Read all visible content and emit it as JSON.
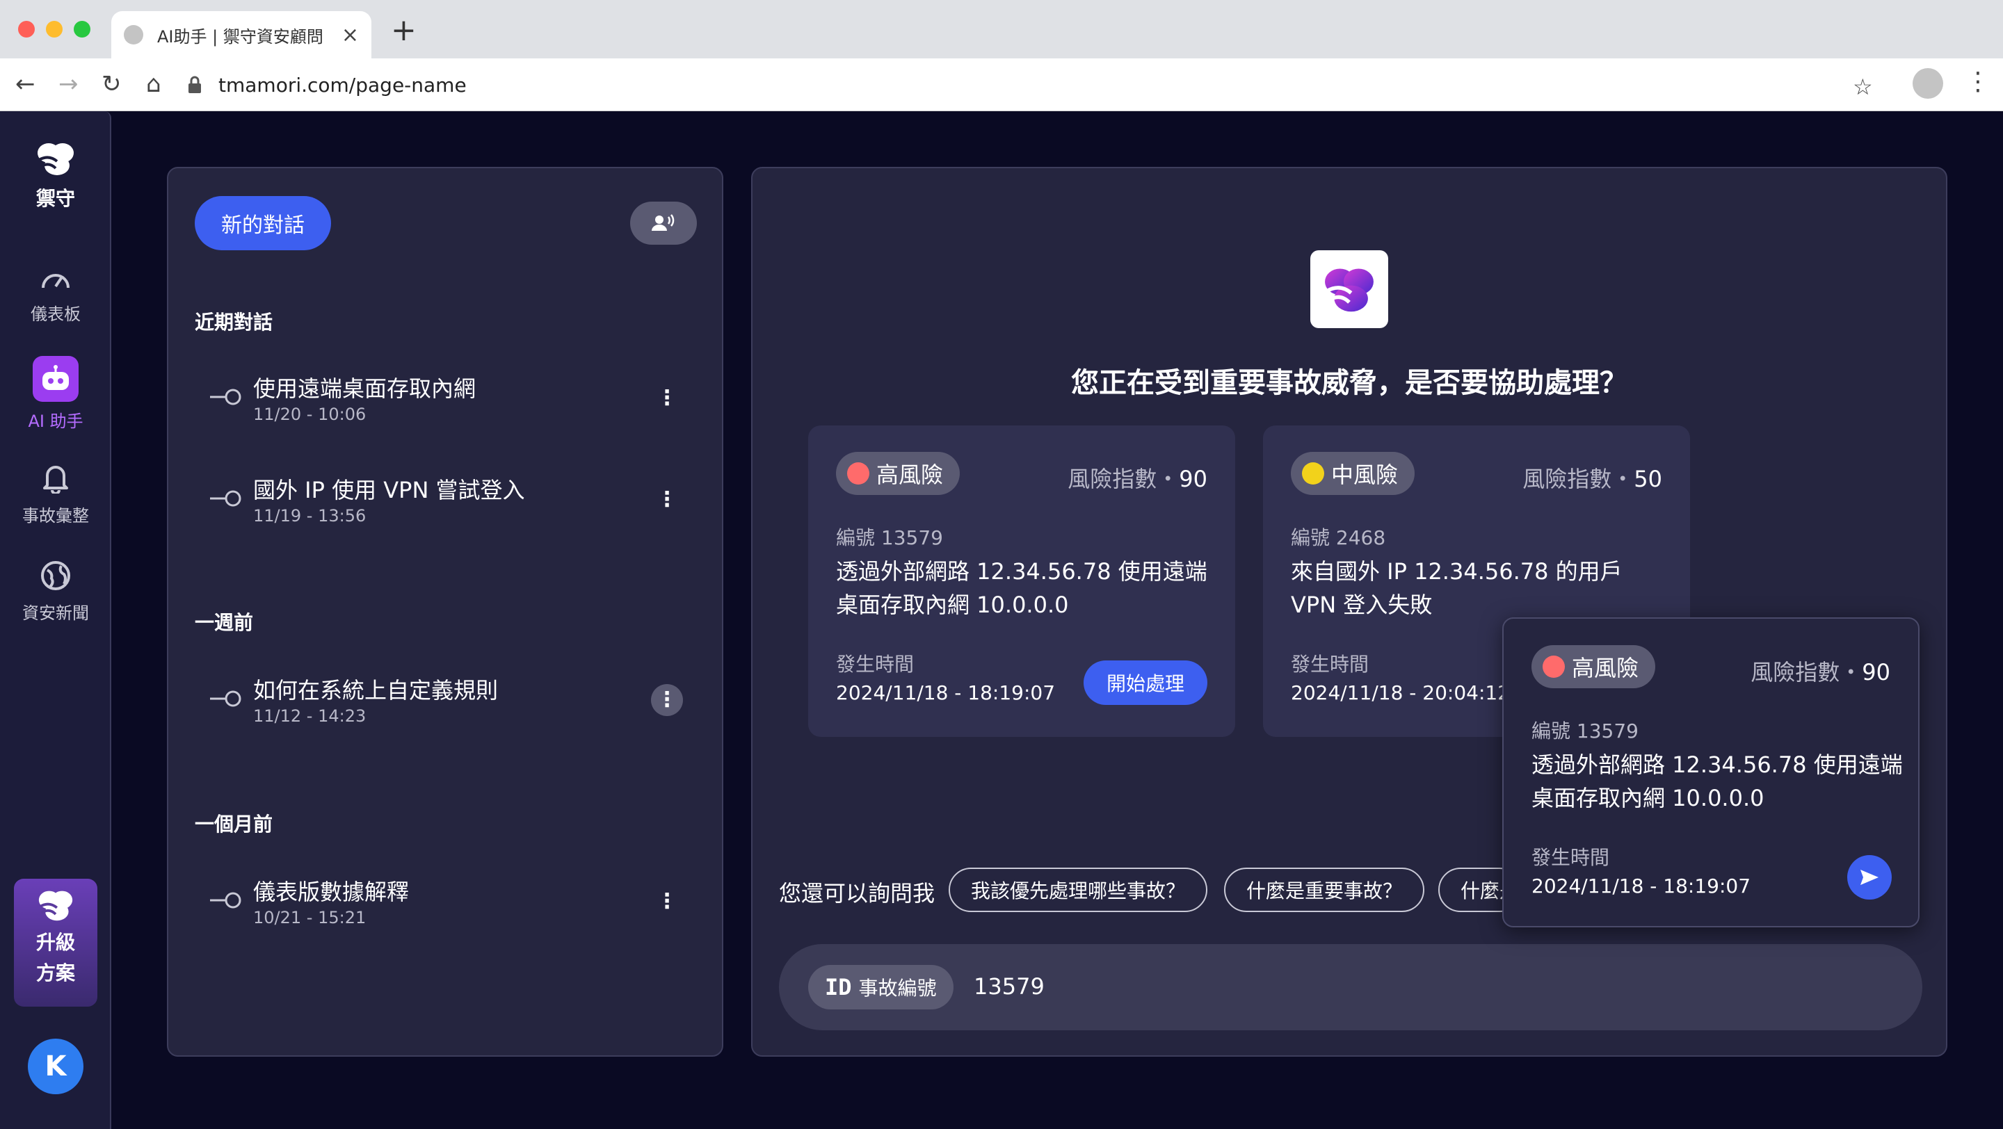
{
  "browser": {
    "tab_title": "AI助手 | 禦守資安顧問",
    "url": "tmamori.com/page-name"
  },
  "nav": {
    "brand": "禦守",
    "items": [
      {
        "label": "儀表板",
        "icon": "speedometer-icon"
      },
      {
        "label": "AI 助手",
        "icon": "robot-icon"
      },
      {
        "label": "事故彙整",
        "icon": "bell-icon"
      },
      {
        "label": "資安新聞",
        "icon": "globe-icon"
      }
    ],
    "upgrade": [
      "升級",
      "方案"
    ],
    "avatar": "K"
  },
  "chatlist": {
    "new_chat": "新的對話",
    "sections": [
      {
        "title": "近期對話",
        "items": [
          {
            "title": "使用遠端桌面存取內網",
            "date": "11/20 - 10:06"
          },
          {
            "title": "國外 IP 使用 VPN 嘗試登入",
            "date": "11/19 - 13:56"
          }
        ]
      },
      {
        "title": "一週前",
        "items": [
          {
            "title": "如何在系統上自定義規則",
            "date": "11/12 - 14:23"
          }
        ]
      },
      {
        "title": "一個月前",
        "items": [
          {
            "title": "儀表版數據解釋",
            "date": "10/21 - 15:21"
          }
        ]
      }
    ]
  },
  "main": {
    "headline": "您正在受到重要事故威脅，是否要協助處理？",
    "cards": [
      {
        "risk": "高風險",
        "risk_color": "#ff6b6b",
        "score_label": "風險指數・",
        "score": "90",
        "id": "編號 13579",
        "desc": "透過外部網路 12.34.56.78 使用遠端桌面存取內網 10.0.0.0",
        "time_label": "發生時間",
        "time": "2024/11/18 -  18:19:07",
        "action": "開始處理"
      },
      {
        "risk": "中風險",
        "risk_color": "#f2d21b",
        "score_label": "風險指數・",
        "score": "50",
        "id": "編號 2468",
        "desc": "來自國外 IP 12.34.56.78 的用戶 VPN 登入失敗",
        "time_label": "發生時間",
        "time": "2024/11/18 - 20:04:12"
      }
    ],
    "popup": {
      "risk": "高風險",
      "risk_color": "#ff6b6b",
      "score_label": "風險指數・",
      "score": "90",
      "id": "編號 13579",
      "desc": "透過外部網路 12.34.56.78 使用遠端桌面存取內網 10.0.0.0",
      "time_label": "發生時間",
      "time": "2024/11/18 -  18:19:07"
    },
    "suggest_label": "您還可以詢問我",
    "suggestions": [
      "我該優先處理哪些事故？",
      "什麼是重要事故？",
      "什麼是"
    ],
    "input": {
      "tag_icon": "ID",
      "tag_label": "事故編號",
      "value": "13579"
    }
  }
}
